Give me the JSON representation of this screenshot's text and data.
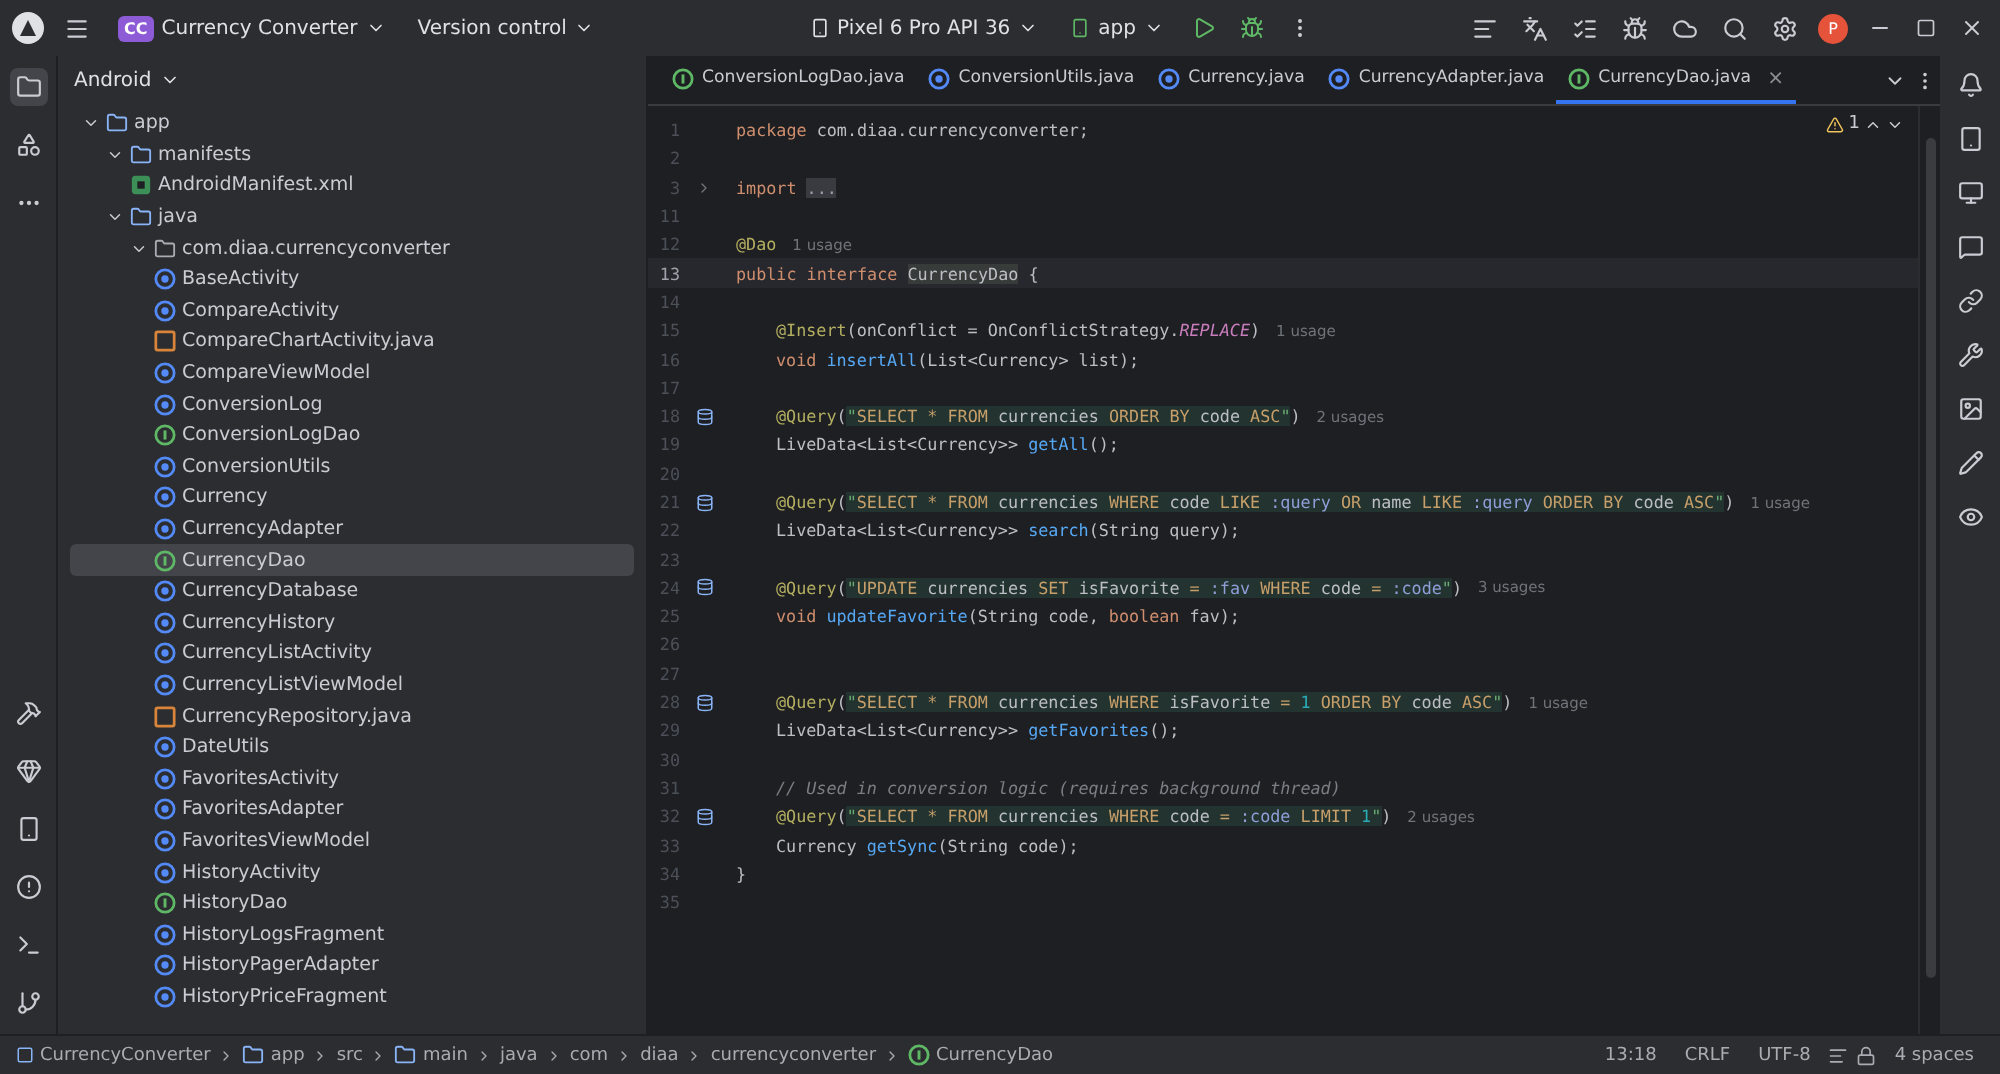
{
  "title_bar": {
    "project_badge": "CC",
    "project": "Currency Converter",
    "version_control": "Version control",
    "device": "Pixel 6 Pro API 36",
    "run_config": "app",
    "avatar": "P"
  },
  "project_panel": {
    "view": "Android",
    "tree": [
      {
        "label": "app",
        "kind": "module",
        "expanded": true,
        "selected": false,
        "children": [
          {
            "label": "manifests",
            "kind": "folder",
            "expanded": true,
            "selected": false,
            "children": [
              {
                "label": "AndroidManifest.xml",
                "kind": "manifest",
                "selected": false
              }
            ]
          },
          {
            "label": "java",
            "kind": "folder",
            "expanded": true,
            "selected": false,
            "children": [
              {
                "label": "com.diaa.currencyconverter",
                "kind": "package",
                "expanded": true,
                "selected": false,
                "children": [
                  {
                    "label": "BaseActivity",
                    "kind": "class",
                    "selected": false
                  },
                  {
                    "label": "CompareActivity",
                    "kind": "class",
                    "selected": false
                  },
                  {
                    "label": "CompareChartActivity.java",
                    "kind": "java-file",
                    "selected": false
                  },
                  {
                    "label": "CompareViewModel",
                    "kind": "class",
                    "selected": false
                  },
                  {
                    "label": "ConversionLog",
                    "kind": "class",
                    "selected": false
                  },
                  {
                    "label": "ConversionLogDao",
                    "kind": "interface",
                    "selected": false
                  },
                  {
                    "label": "ConversionUtils",
                    "kind": "class",
                    "selected": false
                  },
                  {
                    "label": "Currency",
                    "kind": "class",
                    "selected": false
                  },
                  {
                    "label": "CurrencyAdapter",
                    "kind": "class",
                    "selected": false
                  },
                  {
                    "label": "CurrencyDao",
                    "kind": "interface",
                    "selected": true
                  },
                  {
                    "label": "CurrencyDatabase",
                    "kind": "class",
                    "selected": false
                  },
                  {
                    "label": "CurrencyHistory",
                    "kind": "class",
                    "selected": false
                  },
                  {
                    "label": "CurrencyListActivity",
                    "kind": "class",
                    "selected": false
                  },
                  {
                    "label": "CurrencyListViewModel",
                    "kind": "class",
                    "selected": false
                  },
                  {
                    "label": "CurrencyRepository.java",
                    "kind": "java-file",
                    "selected": false
                  },
                  {
                    "label": "DateUtils",
                    "kind": "class",
                    "selected": false
                  },
                  {
                    "label": "FavoritesActivity",
                    "kind": "class",
                    "selected": false
                  },
                  {
                    "label": "FavoritesAdapter",
                    "kind": "class",
                    "selected": false
                  },
                  {
                    "label": "FavoritesViewModel",
                    "kind": "class",
                    "selected": false
                  },
                  {
                    "label": "HistoryActivity",
                    "kind": "class",
                    "selected": false
                  },
                  {
                    "label": "HistoryDao",
                    "kind": "interface",
                    "selected": false
                  },
                  {
                    "label": "HistoryLogsFragment",
                    "kind": "class",
                    "selected": false
                  },
                  {
                    "label": "HistoryPagerAdapter",
                    "kind": "class",
                    "selected": false
                  },
                  {
                    "label": "HistoryPriceFragment",
                    "kind": "class",
                    "selected": false
                  }
                ]
              }
            ]
          }
        ]
      }
    ]
  },
  "tabs": [
    {
      "label": "ConversionLogDao.java",
      "kind": "interface",
      "selected": false
    },
    {
      "label": "ConversionUtils.java",
      "kind": "class",
      "selected": false
    },
    {
      "label": "Currency.java",
      "kind": "class",
      "selected": false
    },
    {
      "label": "CurrencyAdapter.java",
      "kind": "class",
      "selected": false
    },
    {
      "label": "CurrencyDao.java",
      "kind": "interface",
      "selected": true
    }
  ],
  "tab_close": "×",
  "inspection": {
    "count": "1"
  },
  "editor": {
    "lines": [
      {
        "number": "1",
        "kind": "code",
        "current": false,
        "tokens": [
          {
            "kind": "keyword",
            "text": "package"
          },
          {
            "kind": "plain",
            "text": " com.diaa.currencyconverter;"
          }
        ]
      },
      {
        "number": "2",
        "kind": "code",
        "current": false
      },
      {
        "number": "3",
        "kind": "fold",
        "current": false,
        "tokens": [
          {
            "kind": "keyword",
            "text": "import "
          },
          {
            "kind": "folded",
            "text": "..."
          }
        ]
      },
      {
        "number": "11",
        "kind": "code",
        "current": false
      },
      {
        "number": "12",
        "kind": "code",
        "current": false,
        "tokens": [
          {
            "kind": "annotation",
            "text": "@Dao"
          }
        ],
        "hint": "1 usage"
      },
      {
        "number": "13",
        "kind": "code",
        "current": true,
        "tokens": [
          {
            "kind": "keyword",
            "text": "public interface "
          },
          {
            "kind": "highlight",
            "text": "CurrencyDao"
          },
          {
            "kind": "plain",
            "text": " {"
          }
        ],
        "children": [
          {
            "number": "14",
            "kind": "code",
            "current": false
          },
          {
            "number": "15",
            "kind": "code",
            "current": false,
            "tokens": [
              {
                "kind": "annotation",
                "text": "@Insert"
              },
              {
                "kind": "plain",
                "text": "(onConflict = OnConflictStrategy."
              },
              {
                "kind": "constant",
                "text": "REPLACE"
              },
              {
                "kind": "plain",
                "text": ")"
              }
            ],
            "hint": "1 usage"
          },
          {
            "number": "16",
            "kind": "code",
            "current": false,
            "tokens": [
              {
                "kind": "keyword",
                "text": "void "
              },
              {
                "kind": "method",
                "text": "insertAll"
              },
              {
                "kind": "plain",
                "text": "(List<Currency> list);"
              }
            ]
          },
          {
            "number": "17",
            "kind": "code",
            "current": false
          },
          {
            "number": "18",
            "kind": "query",
            "current": false,
            "tokens": [
              {
                "kind": "annotation",
                "text": "@Query"
              },
              {
                "kind": "plain",
                "text": "("
              },
              {
                "kind": "string",
                "text": "\""
              },
              {
                "kind": "sql-keyword",
                "text": "SELECT * FROM"
              },
              {
                "kind": "sql-name",
                "text": " currencies "
              },
              {
                "kind": "sql-keyword",
                "text": "ORDER BY"
              },
              {
                "kind": "sql-name",
                "text": " code "
              },
              {
                "kind": "sql-keyword",
                "text": "ASC"
              },
              {
                "kind": "string",
                "text": "\""
              },
              {
                "kind": "plain",
                "text": ")"
              }
            ],
            "hint": "2 usages"
          },
          {
            "number": "19",
            "kind": "code",
            "current": false,
            "tokens": [
              {
                "kind": "plain",
                "text": "LiveData<List<Currency>> "
              },
              {
                "kind": "method",
                "text": "getAll"
              },
              {
                "kind": "plain",
                "text": "();"
              }
            ]
          },
          {
            "number": "20",
            "kind": "code",
            "current": false
          },
          {
            "number": "21",
            "kind": "query",
            "current": false,
            "tokens": [
              {
                "kind": "annotation",
                "text": "@Query"
              },
              {
                "kind": "plain",
                "text": "("
              },
              {
                "kind": "string",
                "text": "\""
              },
              {
                "kind": "sql-keyword",
                "text": "SELECT * FROM"
              },
              {
                "kind": "sql-name",
                "text": " currencies "
              },
              {
                "kind": "sql-keyword",
                "text": "WHERE"
              },
              {
                "kind": "sql-name",
                "text": " code "
              },
              {
                "kind": "sql-keyword",
                "text": "LIKE "
              },
              {
                "kind": "sql-param",
                "text": ":query"
              },
              {
                "kind": "sql-keyword",
                "text": " OR"
              },
              {
                "kind": "sql-name",
                "text": " name "
              },
              {
                "kind": "sql-keyword",
                "text": "LIKE "
              },
              {
                "kind": "sql-param",
                "text": ":query"
              },
              {
                "kind": "sql-keyword",
                "text": " ORDER BY"
              },
              {
                "kind": "sql-name",
                "text": " code "
              },
              {
                "kind": "sql-keyword",
                "text": "ASC"
              },
              {
                "kind": "string",
                "text": "\""
              },
              {
                "kind": "plain",
                "text": ")"
              }
            ],
            "hint": "1 usage"
          },
          {
            "number": "22",
            "kind": "code",
            "current": false,
            "tokens": [
              {
                "kind": "plain",
                "text": "LiveData<List<Currency>> "
              },
              {
                "kind": "method",
                "text": "search"
              },
              {
                "kind": "plain",
                "text": "(String query);"
              }
            ]
          },
          {
            "number": "23",
            "kind": "code",
            "current": false
          },
          {
            "number": "24",
            "kind": "query",
            "current": false,
            "tokens": [
              {
                "kind": "annotation",
                "text": "@Query"
              },
              {
                "kind": "plain",
                "text": "("
              },
              {
                "kind": "string",
                "text": "\""
              },
              {
                "kind": "sql-keyword",
                "text": "UPDATE"
              },
              {
                "kind": "sql-name",
                "text": " currencies "
              },
              {
                "kind": "sql-keyword",
                "text": "SET"
              },
              {
                "kind": "sql-name",
                "text": " isFavorite "
              },
              {
                "kind": "sql-keyword",
                "text": "= "
              },
              {
                "kind": "sql-param",
                "text": ":fav"
              },
              {
                "kind": "sql-keyword",
                "text": " WHERE"
              },
              {
                "kind": "sql-name",
                "text": " code "
              },
              {
                "kind": "sql-keyword",
                "text": "= "
              },
              {
                "kind": "sql-param",
                "text": ":code"
              },
              {
                "kind": "string",
                "text": "\""
              },
              {
                "kind": "plain",
                "text": ")"
              }
            ],
            "hint": "3 usages"
          },
          {
            "number": "25",
            "kind": "code",
            "current": false,
            "tokens": [
              {
                "kind": "keyword",
                "text": "void "
              },
              {
                "kind": "method",
                "text": "updateFavorite"
              },
              {
                "kind": "plain",
                "text": "(String code, "
              },
              {
                "kind": "keyword",
                "text": "boolean"
              },
              {
                "kind": "plain",
                "text": " fav);"
              }
            ]
          },
          {
            "number": "26",
            "kind": "code",
            "current": false
          },
          {
            "number": "27",
            "kind": "code",
            "current": false
          },
          {
            "number": "28",
            "kind": "query",
            "current": false,
            "tokens": [
              {
                "kind": "annotation",
                "text": "@Query"
              },
              {
                "kind": "plain",
                "text": "("
              },
              {
                "kind": "string",
                "text": "\""
              },
              {
                "kind": "sql-keyword",
                "text": "SELECT * FROM"
              },
              {
                "kind": "sql-name",
                "text": " currencies "
              },
              {
                "kind": "sql-keyword",
                "text": "WHERE"
              },
              {
                "kind": "sql-name",
                "text": " isFavorite "
              },
              {
                "kind": "sql-keyword",
                "text": "= "
              },
              {
                "kind": "sql-number",
                "text": "1"
              },
              {
                "kind": "sql-keyword",
                "text": " ORDER BY"
              },
              {
                "kind": "sql-name",
                "text": " code "
              },
              {
                "kind": "sql-keyword",
                "text": "ASC"
              },
              {
                "kind": "string",
                "text": "\""
              },
              {
                "kind": "plain",
                "text": ")"
              }
            ],
            "hint": "1 usage"
          },
          {
            "number": "29",
            "kind": "code",
            "current": false,
            "tokens": [
              {
                "kind": "plain",
                "text": "LiveData<List<Currency>> "
              },
              {
                "kind": "method",
                "text": "getFavorites"
              },
              {
                "kind": "plain",
                "text": "();"
              }
            ]
          },
          {
            "number": "30",
            "kind": "code",
            "current": false
          },
          {
            "number": "31",
            "kind": "code",
            "current": false,
            "tokens": [
              {
                "kind": "comment",
                "text": "// Used in conversion logic (requires background thread)"
              }
            ]
          },
          {
            "number": "32",
            "kind": "query",
            "current": false,
            "tokens": [
              {
                "kind": "annotation",
                "text": "@Query"
              },
              {
                "kind": "plain",
                "text": "("
              },
              {
                "kind": "string",
                "text": "\""
              },
              {
                "kind": "sql-keyword",
                "text": "SELECT * FROM"
              },
              {
                "kind": "sql-name",
                "text": " currencies "
              },
              {
                "kind": "sql-keyword",
                "text": "WHERE"
              },
              {
                "kind": "sql-name",
                "text": " code "
              },
              {
                "kind": "sql-keyword",
                "text": "= "
              },
              {
                "kind": "sql-param",
                "text": ":code"
              },
              {
                "kind": "sql-keyword",
                "text": " LIMIT "
              },
              {
                "kind": "sql-number",
                "text": "1"
              },
              {
                "kind": "string",
                "text": "\""
              },
              {
                "kind": "plain",
                "text": ")"
              }
            ],
            "hint": "2 usages"
          },
          {
            "number": "33",
            "kind": "code",
            "current": false,
            "tokens": [
              {
                "kind": "plain",
                "text": "Currency "
              },
              {
                "kind": "method",
                "text": "getSync"
              },
              {
                "kind": "plain",
                "text": "(String code);"
              }
            ]
          }
        ]
      },
      {
        "number": "34",
        "kind": "code",
        "current": false,
        "tokens": [
          {
            "kind": "plain",
            "text": "}"
          }
        ]
      },
      {
        "number": "35",
        "kind": "code",
        "current": false
      }
    ]
  },
  "breadcrumbs": [
    {
      "label": "CurrencyConverter",
      "kind": "project"
    },
    {
      "label": "app",
      "kind": "module"
    },
    {
      "label": "src",
      "kind": "plain"
    },
    {
      "label": "main",
      "kind": "module"
    },
    {
      "label": "java",
      "kind": "plain"
    },
    {
      "label": "com",
      "kind": "plain"
    },
    {
      "label": "diaa",
      "kind": "plain"
    },
    {
      "label": "currencyconverter",
      "kind": "plain"
    },
    {
      "label": "CurrencyDao",
      "kind": "interface"
    }
  ],
  "status_bar": {
    "position": "13:18",
    "line_separator": "CRLF",
    "encoding": "UTF-8",
    "indent": "4 spaces"
  }
}
